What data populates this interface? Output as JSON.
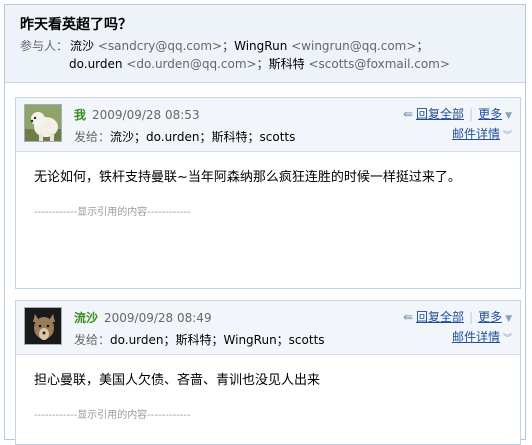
{
  "thread": {
    "subject": "昨天看英超了吗？",
    "participants_label": "参与人：",
    "participants": [
      {
        "name": "流沙",
        "email": "<sandcry@qq.com>"
      },
      {
        "name": "WingRun",
        "email": "<wingrun@qq.com>"
      },
      {
        "name": "do.urden",
        "email": "<do.urden@qq.com>"
      },
      {
        "name": "斯科特",
        "email": "<scotts@foxmail.com>"
      }
    ],
    "separator": "；"
  },
  "messages": [
    {
      "sender": "我",
      "time": "2009/09/28 08:53",
      "to_label": "发给：",
      "to": "流沙；do.urden；斯科特；scotts",
      "reply_all": "回复全部",
      "more": "更多",
      "details": "邮件详情",
      "body": "无论如何，铁杆支持曼联~当年阿森纳那么疯狂连胜的时候一样挺过来了。",
      "quote_toggle": "------------显示引用的内容------------"
    },
    {
      "sender": "流沙",
      "time": "2009/09/28 08:49",
      "to_label": "发给：",
      "to": "do.urden；斯科特；WingRun；scotts",
      "reply_all": "回复全部",
      "more": "更多",
      "details": "邮件详情",
      "body": "担心曼联，美国人欠债、吝啬、青训也没见人出来",
      "quote_toggle": "------------显示引用的内容------------"
    }
  ],
  "icons": {
    "reply": "reply-arrow-icon",
    "caret": "chevron-down-icon",
    "details": "double-chevron-down-icon"
  }
}
